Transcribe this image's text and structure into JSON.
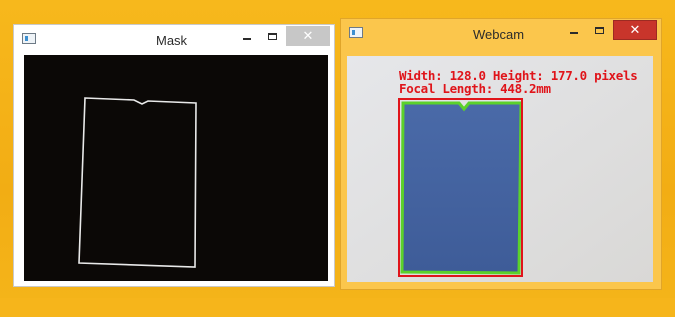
{
  "windows": {
    "mask": {
      "title": "Mask",
      "icon": "app-window-icon",
      "controls": {
        "minimize": "minimize-icon",
        "maximize": "maximize-icon",
        "close": "close-icon",
        "close_glyph": "✕"
      }
    },
    "webcam": {
      "title": "Webcam",
      "icon": "app-window-icon",
      "overlay": {
        "line1": "Width: 128.0 Height: 177.0 pixels",
        "line2": "Focal Length: 448.2mm",
        "text_color": "#e0141a",
        "box_color": "#e0141a",
        "contour_color": "#5bd12b"
      },
      "controls": {
        "minimize": "minimize-icon",
        "maximize": "maximize-icon",
        "close": "close-icon",
        "close_glyph": "✕"
      }
    }
  },
  "colors": {
    "desktop": "#f2ad14",
    "active_frame": "#fbc64c",
    "close_active": "#c8352b"
  }
}
